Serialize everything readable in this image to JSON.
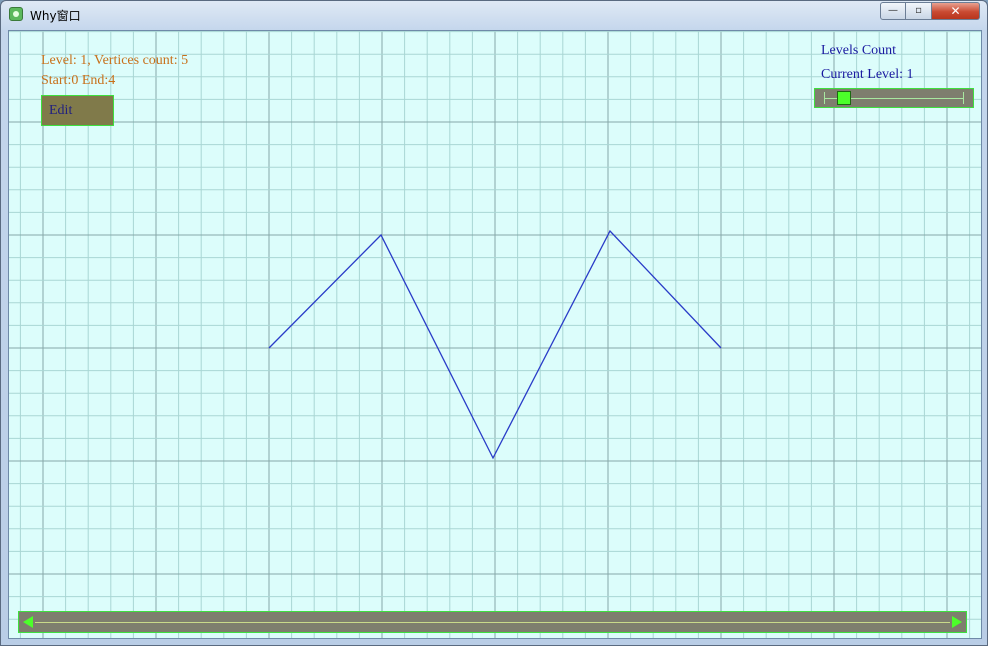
{
  "window": {
    "title": "Why窗口",
    "minimize_glyph": "—",
    "maximize_glyph": "▫",
    "close_glyph": "✕"
  },
  "info": {
    "level_line": "Level: 1, Vertices count: 5",
    "start_end_line": "Start:0 End:4"
  },
  "toolbar": {
    "edit_label": "Edit"
  },
  "levels_panel": {
    "levels_count_label": "Levels Count",
    "current_level_label": "Current Level: 1",
    "slider_value_fraction": 0.1
  },
  "colors": {
    "canvas_bg": "#dcfdfb",
    "grid_minor": "#a9d6d4",
    "grid_major": "#86a8a8",
    "polyline": "#2a3cc8",
    "info_text": "#c8701a",
    "panel_text": "#1a1aa0",
    "control_border": "#3ee03e",
    "control_bg": "#7e7e6e",
    "thumb": "#4cff2a"
  },
  "icons": {
    "app": "app-icon",
    "scroll_left": "scroll-left-arrow-icon",
    "scroll_right": "scroll-right-arrow-icon"
  }
}
